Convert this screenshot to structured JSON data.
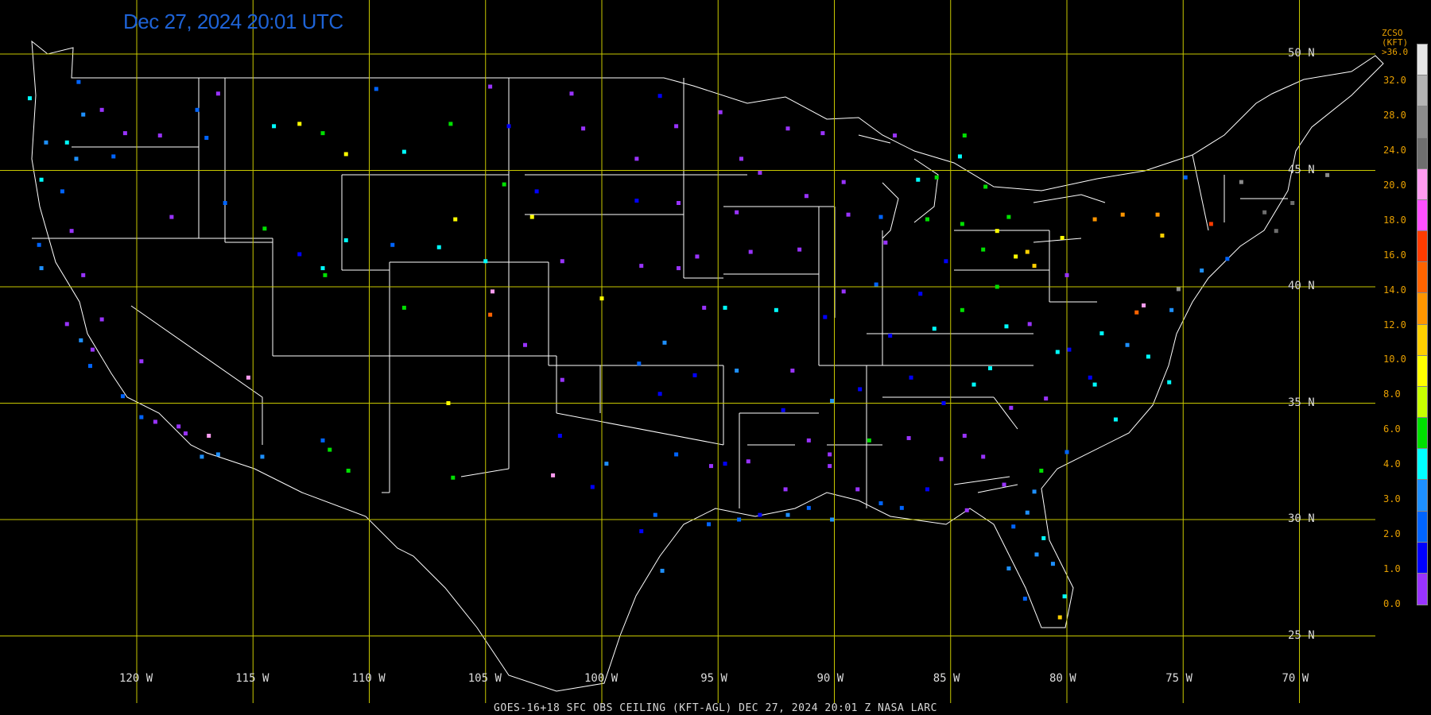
{
  "header": {
    "timestamp": "Dec 27, 2024 20:01 UTC"
  },
  "footer": {
    "caption": "GOES-16+18  SFC OBS CEILING (KFT-AGL)   DEC 27, 2024 20:01 Z   NASA LARC"
  },
  "map": {
    "projection": "equirectangular",
    "gridline_color": "#c8c800",
    "border_color": "#ffffff",
    "lat_labels": [
      "50 N",
      "45 N",
      "40 N",
      "35 N",
      "30 N",
      "25 N"
    ],
    "lat_values": [
      50,
      45,
      40,
      35,
      30,
      25
    ],
    "lon_labels": [
      "120 W",
      "115 W",
      "110 W",
      "105 W",
      "100 W",
      "95 W",
      "90 W",
      "85 W",
      "80 W",
      "75 W",
      "70 W"
    ],
    "lon_values": [
      -120,
      -115,
      -110,
      -105,
      -100,
      -95,
      -90,
      -85,
      -80,
      -75,
      -70
    ]
  },
  "legend": {
    "title_line1": "ZCSO (KFT)",
    "title_line2": ">36.0",
    "labels": [
      "32.0",
      "28.0",
      "24.0",
      "20.0",
      "18.0",
      "16.0",
      "14.0",
      "12.0",
      "10.0",
      "8.0",
      "6.0",
      "4.0",
      "3.0",
      "2.0",
      "1.0",
      "0.0"
    ],
    "colors": [
      "#e6e6e6",
      "#b4b4b4",
      "#8c8c8c",
      "#6e6e6e",
      "#ff9cf0",
      "#ff50ff",
      "#ff3c00",
      "#ff6400",
      "#ff9600",
      "#ffd000",
      "#ffff00",
      "#c8ff00",
      "#00e000",
      "#00ffff",
      "#1e90ff",
      "#0064ff",
      "#0000ff",
      "#9933ff"
    ]
  },
  "stations": [
    {
      "lon": -121.5,
      "lat": 47.6,
      "c": "#9933ff"
    },
    {
      "lon": -122.3,
      "lat": 47.4,
      "c": "#1e90ff"
    },
    {
      "lon": -123.0,
      "lat": 46.2,
      "c": "#00ffff"
    },
    {
      "lon": -122.6,
      "lat": 45.5,
      "c": "#1e90ff"
    },
    {
      "lon": -121.0,
      "lat": 45.6,
      "c": "#0064ff"
    },
    {
      "lon": -119.0,
      "lat": 46.5,
      "c": "#9933ff"
    },
    {
      "lon": -117.4,
      "lat": 47.6,
      "c": "#0064ff"
    },
    {
      "lon": -116.5,
      "lat": 48.3,
      "c": "#9933ff"
    },
    {
      "lon": -112.0,
      "lat": 46.6,
      "c": "#00e000"
    },
    {
      "lon": -108.5,
      "lat": 45.8,
      "c": "#00ffff"
    },
    {
      "lon": -111.0,
      "lat": 45.7,
      "c": "#ffff00"
    },
    {
      "lon": -106.5,
      "lat": 47.0,
      "c": "#00e000"
    },
    {
      "lon": -104.0,
      "lat": 46.9,
      "c": "#0000ff"
    },
    {
      "lon": -103.0,
      "lat": 43.0,
      "c": "#ffff00"
    },
    {
      "lon": -100.8,
      "lat": 46.8,
      "c": "#9933ff"
    },
    {
      "lon": -98.5,
      "lat": 45.5,
      "c": "#9933ff"
    },
    {
      "lon": -96.8,
      "lat": 46.9,
      "c": "#9933ff"
    },
    {
      "lon": -94.0,
      "lat": 45.5,
      "c": "#9933ff"
    },
    {
      "lon": -93.2,
      "lat": 44.9,
      "c": "#9933ff"
    },
    {
      "lon": -92.0,
      "lat": 46.8,
      "c": "#9933ff"
    },
    {
      "lon": -89.6,
      "lat": 44.5,
      "c": "#9933ff"
    },
    {
      "lon": -88.0,
      "lat": 43.0,
      "c": "#0064ff"
    },
    {
      "lon": -87.8,
      "lat": 41.9,
      "c": "#9933ff"
    },
    {
      "lon": -86.0,
      "lat": 42.9,
      "c": "#00e000"
    },
    {
      "lon": -84.5,
      "lat": 42.7,
      "c": "#00e000"
    },
    {
      "lon": -83.0,
      "lat": 42.4,
      "c": "#ffff00"
    },
    {
      "lon": -81.7,
      "lat": 41.5,
      "c": "#ffd000"
    },
    {
      "lon": -80.0,
      "lat": 40.5,
      "c": "#9933ff"
    },
    {
      "lon": -78.8,
      "lat": 42.9,
      "c": "#ff9600"
    },
    {
      "lon": -76.1,
      "lat": 43.1,
      "c": "#ff9600"
    },
    {
      "lon": -73.8,
      "lat": 42.7,
      "c": "#ff3c00"
    },
    {
      "lon": -71.0,
      "lat": 42.4,
      "c": "#6e6e6e"
    },
    {
      "lon": -72.5,
      "lat": 44.5,
      "c": "#8c8c8c"
    },
    {
      "lon": -75.2,
      "lat": 39.9,
      "c": "#8c8c8c"
    },
    {
      "lon": -77.0,
      "lat": 38.9,
      "c": "#ff6400"
    },
    {
      "lon": -76.5,
      "lat": 37.0,
      "c": "#00ffff"
    },
    {
      "lon": -78.8,
      "lat": 35.8,
      "c": "#00ffff"
    },
    {
      "lon": -80.9,
      "lat": 35.2,
      "c": "#9933ff"
    },
    {
      "lon": -84.4,
      "lat": 33.6,
      "c": "#9933ff"
    },
    {
      "lon": -86.8,
      "lat": 33.5,
      "c": "#9933ff"
    },
    {
      "lon": -90.1,
      "lat": 35.1,
      "c": "#1e90ff"
    },
    {
      "lon": -92.2,
      "lat": 34.7,
      "c": "#0000ff"
    },
    {
      "lon": -97.5,
      "lat": 35.4,
      "c": "#0000ff"
    },
    {
      "lon": -97.3,
      "lat": 37.6,
      "c": "#1e90ff"
    },
    {
      "lon": -95.9,
      "lat": 41.3,
      "c": "#9933ff"
    },
    {
      "lon": -94.7,
      "lat": 39.1,
      "c": "#00ffff"
    },
    {
      "lon": -90.4,
      "lat": 38.7,
      "c": "#0000ff"
    },
    {
      "lon": -86.3,
      "lat": 39.7,
      "c": "#0000ff"
    },
    {
      "lon": -85.7,
      "lat": 38.2,
      "c": "#00ffff"
    },
    {
      "lon": -84.5,
      "lat": 39.0,
      "c": "#00e000"
    },
    {
      "lon": -83.0,
      "lat": 40.0,
      "c": "#00e000"
    },
    {
      "lon": -81.6,
      "lat": 38.4,
      "c": "#9933ff"
    },
    {
      "lon": -86.7,
      "lat": 36.1,
      "c": "#0000ff"
    },
    {
      "lon": -84.0,
      "lat": 35.8,
      "c": "#00ffff"
    },
    {
      "lon": -90.1,
      "lat": 30.0,
      "c": "#1e90ff"
    },
    {
      "lon": -91.1,
      "lat": 30.5,
      "c": "#0064ff"
    },
    {
      "lon": -95.4,
      "lat": 29.8,
      "c": "#0064ff"
    },
    {
      "lon": -97.7,
      "lat": 30.2,
      "c": "#0064ff"
    },
    {
      "lon": -97.4,
      "lat": 27.8,
      "c": "#1e90ff"
    },
    {
      "lon": -88.0,
      "lat": 30.7,
      "c": "#0064ff"
    },
    {
      "lon": -84.3,
      "lat": 30.4,
      "c": "#9933ff"
    },
    {
      "lon": -81.7,
      "lat": 30.3,
      "c": "#1e90ff"
    },
    {
      "lon": -81.3,
      "lat": 28.5,
      "c": "#1e90ff"
    },
    {
      "lon": -82.5,
      "lat": 27.9,
      "c": "#1e90ff"
    },
    {
      "lon": -80.3,
      "lat": 25.8,
      "c": "#ffd000"
    },
    {
      "lon": -80.1,
      "lat": 26.7,
      "c": "#00ffff"
    },
    {
      "lon": -81.1,
      "lat": 32.1,
      "c": "#00e000"
    },
    {
      "lon": -80.0,
      "lat": 32.9,
      "c": "#0064ff"
    },
    {
      "lon": -77.9,
      "lat": 34.3,
      "c": "#00ffff"
    },
    {
      "lon": -75.6,
      "lat": 35.9,
      "c": "#00ffff"
    },
    {
      "lon": -117.2,
      "lat": 32.7,
      "c": "#1e90ff"
    },
    {
      "lon": -118.2,
      "lat": 34.0,
      "c": "#9933ff"
    },
    {
      "lon": -119.8,
      "lat": 34.4,
      "c": "#0064ff"
    },
    {
      "lon": -120.6,
      "lat": 35.3,
      "c": "#0064ff"
    },
    {
      "lon": -121.9,
      "lat": 37.3,
      "c": "#9933ff"
    },
    {
      "lon": -122.4,
      "lat": 37.7,
      "c": "#1e90ff"
    },
    {
      "lon": -121.5,
      "lat": 38.6,
      "c": "#9933ff"
    },
    {
      "lon": -119.8,
      "lat": 36.8,
      "c": "#9933ff"
    },
    {
      "lon": -124.2,
      "lat": 41.8,
      "c": "#0064ff"
    },
    {
      "lon": -122.8,
      "lat": 42.4,
      "c": "#9933ff"
    },
    {
      "lon": -116.2,
      "lat": 43.6,
      "c": "#0064ff"
    },
    {
      "lon": -112.0,
      "lat": 40.8,
      "c": "#00ffff"
    },
    {
      "lon": -111.9,
      "lat": 40.5,
      "c": "#00e000"
    },
    {
      "lon": -108.5,
      "lat": 39.1,
      "c": "#00e000"
    },
    {
      "lon": -104.7,
      "lat": 39.8,
      "c": "#ff9cf0"
    },
    {
      "lon": -104.8,
      "lat": 38.8,
      "c": "#ff6400"
    },
    {
      "lon": -106.6,
      "lat": 35.0,
      "c": "#ffff00"
    },
    {
      "lon": -102.1,
      "lat": 31.9,
      "c": "#ff9cf0"
    },
    {
      "lon": -111.7,
      "lat": 33.0,
      "c": "#00e000"
    },
    {
      "lon": -115.2,
      "lat": 36.1,
      "c": "#ff9cf0"
    },
    {
      "lon": -116.9,
      "lat": 33.6,
      "c": "#ff9cf0"
    },
    {
      "lon": -105.0,
      "lat": 41.1,
      "c": "#00ffff"
    },
    {
      "lon": -100.0,
      "lat": 39.5,
      "c": "#ffff00"
    },
    {
      "lon": -96.8,
      "lat": 32.8,
      "c": "#0064ff"
    },
    {
      "lon": -93.7,
      "lat": 32.5,
      "c": "#9933ff"
    },
    {
      "lon": -90.2,
      "lat": 32.3,
      "c": "#9933ff"
    },
    {
      "lon": -88.5,
      "lat": 33.4,
      "c": "#00e000"
    },
    {
      "lon": -85.4,
      "lat": 32.6,
      "c": "#9933ff"
    },
    {
      "lon": -83.6,
      "lat": 32.7,
      "c": "#9933ff"
    },
    {
      "lon": -82.4,
      "lat": 34.8,
      "c": "#9933ff"
    },
    {
      "lon": -79.0,
      "lat": 36.1,
      "c": "#0000ff"
    },
    {
      "lon": -77.4,
      "lat": 37.5,
      "c": "#1e90ff"
    },
    {
      "lon": -79.9,
      "lat": 37.3,
      "c": "#0000ff"
    },
    {
      "lon": -82.6,
      "lat": 38.3,
      "c": "#00ffff"
    },
    {
      "lon": -87.6,
      "lat": 37.9,
      "c": "#0000ff"
    },
    {
      "lon": -89.6,
      "lat": 39.8,
      "c": "#9933ff"
    },
    {
      "lon": -91.5,
      "lat": 41.6,
      "c": "#9933ff"
    },
    {
      "lon": -93.6,
      "lat": 41.5,
      "c": "#9933ff"
    },
    {
      "lon": -96.7,
      "lat": 40.8,
      "c": "#9933ff"
    },
    {
      "lon": -98.3,
      "lat": 40.9,
      "c": "#9933ff"
    },
    {
      "lon": -101.7,
      "lat": 41.1,
      "c": "#9933ff"
    },
    {
      "lon": -98.5,
      "lat": 43.7,
      "c": "#0000ff"
    },
    {
      "lon": -96.7,
      "lat": 43.6,
      "c": "#9933ff"
    },
    {
      "lon": -94.2,
      "lat": 43.2,
      "c": "#9933ff"
    },
    {
      "lon": -91.2,
      "lat": 43.9,
      "c": "#9933ff"
    },
    {
      "lon": -89.4,
      "lat": 43.1,
      "c": "#9933ff"
    },
    {
      "lon": -86.4,
      "lat": 44.6,
      "c": "#00ffff"
    },
    {
      "lon": -84.4,
      "lat": 46.5,
      "c": "#00e000"
    },
    {
      "lon": -87.4,
      "lat": 46.5,
      "c": "#9933ff"
    },
    {
      "lon": -90.5,
      "lat": 46.6,
      "c": "#9933ff"
    },
    {
      "lon": -94.9,
      "lat": 47.5,
      "c": "#9933ff"
    },
    {
      "lon": -97.5,
      "lat": 48.2,
      "c": "#0000ff"
    },
    {
      "lon": -101.3,
      "lat": 48.3,
      "c": "#9933ff"
    },
    {
      "lon": -104.8,
      "lat": 48.6,
      "c": "#9933ff"
    },
    {
      "lon": -109.7,
      "lat": 48.5,
      "c": "#0064ff"
    },
    {
      "lon": -113.0,
      "lat": 47.0,
      "c": "#ffff00"
    },
    {
      "lon": -114.1,
      "lat": 46.9,
      "c": "#00ffff"
    },
    {
      "lon": -117.0,
      "lat": 46.4,
      "c": "#0064ff"
    },
    {
      "lon": -120.5,
      "lat": 46.6,
      "c": "#9933ff"
    },
    {
      "lon": -71.5,
      "lat": 43.2,
      "c": "#6e6e6e"
    },
    {
      "lon": -70.3,
      "lat": 43.6,
      "c": "#6e6e6e"
    },
    {
      "lon": -68.8,
      "lat": 44.8,
      "c": "#8c8c8c"
    },
    {
      "lon": -73.1,
      "lat": 41.2,
      "c": "#0064ff"
    },
    {
      "lon": -74.2,
      "lat": 40.7,
      "c": "#1e90ff"
    },
    {
      "lon": -75.5,
      "lat": 39.0,
      "c": "#1e90ff"
    },
    {
      "lon": -76.7,
      "lat": 39.2,
      "c": "#ff9cf0"
    },
    {
      "lon": -78.5,
      "lat": 38.0,
      "c": "#00ffff"
    },
    {
      "lon": -80.4,
      "lat": 37.2,
      "c": "#00ffff"
    },
    {
      "lon": -83.3,
      "lat": 36.5,
      "c": "#00ffff"
    },
    {
      "lon": -85.3,
      "lat": 35.0,
      "c": "#0000ff"
    },
    {
      "lon": -88.9,
      "lat": 35.6,
      "c": "#0000ff"
    },
    {
      "lon": -91.8,
      "lat": 36.4,
      "c": "#9933ff"
    },
    {
      "lon": -94.2,
      "lat": 36.4,
      "c": "#1e90ff"
    },
    {
      "lon": -96.0,
      "lat": 36.2,
      "c": "#0000ff"
    },
    {
      "lon": -98.4,
      "lat": 36.7,
      "c": "#0064ff"
    },
    {
      "lon": -101.7,
      "lat": 36.0,
      "c": "#9933ff"
    },
    {
      "lon": -103.3,
      "lat": 37.5,
      "c": "#9933ff"
    },
    {
      "lon": -95.6,
      "lat": 39.1,
      "c": "#9933ff"
    },
    {
      "lon": -92.5,
      "lat": 39.0,
      "c": "#00ffff"
    },
    {
      "lon": -88.2,
      "lat": 40.1,
      "c": "#0064ff"
    },
    {
      "lon": -85.2,
      "lat": 41.1,
      "c": "#0000ff"
    },
    {
      "lon": -83.6,
      "lat": 41.6,
      "c": "#00e000"
    },
    {
      "lon": -82.2,
      "lat": 41.3,
      "c": "#ffff00"
    },
    {
      "lon": -81.4,
      "lat": 40.9,
      "c": "#ffd000"
    },
    {
      "lon": -80.2,
      "lat": 42.1,
      "c": "#ffff00"
    },
    {
      "lon": -77.6,
      "lat": 43.1,
      "c": "#ff9600"
    },
    {
      "lon": -75.9,
      "lat": 42.2,
      "c": "#ffd000"
    },
    {
      "lon": -74.9,
      "lat": 44.7,
      "c": "#0064ff"
    },
    {
      "lon": -84.6,
      "lat": 45.6,
      "c": "#00ffff"
    },
    {
      "lon": -85.6,
      "lat": 44.7,
      "c": "#00e000"
    },
    {
      "lon": -83.5,
      "lat": 44.3,
      "c": "#00e000"
    },
    {
      "lon": -82.5,
      "lat": 43.0,
      "c": "#00e000"
    },
    {
      "lon": -89.0,
      "lat": 31.3,
      "c": "#9933ff"
    },
    {
      "lon": -87.1,
      "lat": 30.5,
      "c": "#0064ff"
    },
    {
      "lon": -86.0,
      "lat": 31.3,
      "c": "#0000ff"
    },
    {
      "lon": -82.7,
      "lat": 31.5,
      "c": "#9933ff"
    },
    {
      "lon": -81.4,
      "lat": 31.2,
      "c": "#1e90ff"
    },
    {
      "lon": -82.3,
      "lat": 29.7,
      "c": "#0064ff"
    },
    {
      "lon": -81.0,
      "lat": 29.2,
      "c": "#00ffff"
    },
    {
      "lon": -80.6,
      "lat": 28.1,
      "c": "#1e90ff"
    },
    {
      "lon": -81.8,
      "lat": 26.6,
      "c": "#0064ff"
    },
    {
      "lon": -93.2,
      "lat": 30.2,
      "c": "#0000ff"
    },
    {
      "lon": -94.1,
      "lat": 30.0,
      "c": "#0064ff"
    },
    {
      "lon": -92.0,
      "lat": 30.2,
      "c": "#1e90ff"
    },
    {
      "lon": -90.2,
      "lat": 32.8,
      "c": "#9933ff"
    },
    {
      "lon": -91.1,
      "lat": 33.4,
      "c": "#9933ff"
    },
    {
      "lon": -92.1,
      "lat": 31.3,
      "c": "#9933ff"
    },
    {
      "lon": -94.7,
      "lat": 32.4,
      "c": "#0000ff"
    },
    {
      "lon": -95.3,
      "lat": 32.3,
      "c": "#9933ff"
    },
    {
      "lon": -98.3,
      "lat": 29.5,
      "c": "#0000ff"
    },
    {
      "lon": -99.8,
      "lat": 32.4,
      "c": "#1e90ff"
    },
    {
      "lon": -101.8,
      "lat": 33.6,
      "c": "#0000ff"
    },
    {
      "lon": -100.4,
      "lat": 31.4,
      "c": "#0000ff"
    },
    {
      "lon": -106.4,
      "lat": 31.8,
      "c": "#00e000"
    },
    {
      "lon": -110.9,
      "lat": 32.1,
      "c": "#00e000"
    },
    {
      "lon": -112.0,
      "lat": 33.4,
      "c": "#0064ff"
    },
    {
      "lon": -114.6,
      "lat": 32.7,
      "c": "#1e90ff"
    },
    {
      "lon": -116.5,
      "lat": 32.8,
      "c": "#1e90ff"
    },
    {
      "lon": -117.9,
      "lat": 33.7,
      "c": "#9933ff"
    },
    {
      "lon": -119.2,
      "lat": 34.2,
      "c": "#9933ff"
    },
    {
      "lon": -122.0,
      "lat": 36.6,
      "c": "#0064ff"
    },
    {
      "lon": -123.0,
      "lat": 38.4,
      "c": "#9933ff"
    },
    {
      "lon": -122.3,
      "lat": 40.5,
      "c": "#9933ff"
    },
    {
      "lon": -124.1,
      "lat": 40.8,
      "c": "#1e90ff"
    },
    {
      "lon": -123.2,
      "lat": 44.1,
      "c": "#0064ff"
    },
    {
      "lon": -124.1,
      "lat": 44.6,
      "c": "#00ffff"
    },
    {
      "lon": -123.9,
      "lat": 46.2,
      "c": "#1e90ff"
    },
    {
      "lon": -124.6,
      "lat": 48.1,
      "c": "#00ffff"
    },
    {
      "lon": -122.5,
      "lat": 48.8,
      "c": "#0064ff"
    },
    {
      "lon": -118.5,
      "lat": 43.0,
      "c": "#9933ff"
    },
    {
      "lon": -114.5,
      "lat": 42.5,
      "c": "#00e000"
    },
    {
      "lon": -113.0,
      "lat": 41.4,
      "c": "#0000ff"
    },
    {
      "lon": -111.0,
      "lat": 42.0,
      "c": "#00ffff"
    },
    {
      "lon": -109.0,
      "lat": 41.8,
      "c": "#0064ff"
    },
    {
      "lon": -107.0,
      "lat": 41.7,
      "c": "#00ffff"
    },
    {
      "lon": -106.3,
      "lat": 42.9,
      "c": "#ffff00"
    },
    {
      "lon": -104.2,
      "lat": 44.4,
      "c": "#00e000"
    },
    {
      "lon": -102.8,
      "lat": 44.1,
      "c": "#0000ff"
    }
  ]
}
